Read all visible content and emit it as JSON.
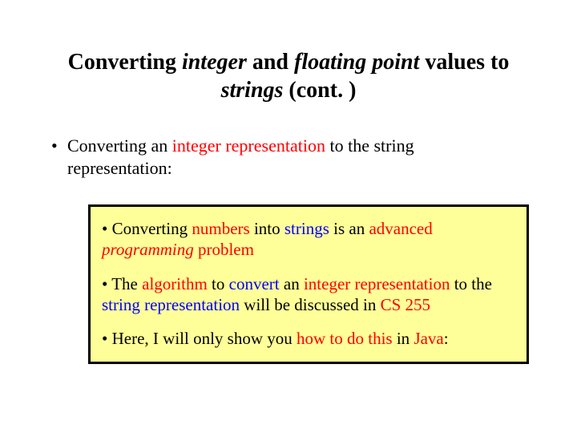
{
  "title": {
    "p1": "Converting ",
    "p2": "integer",
    "p3": " and ",
    "p4": "floating point",
    "p5": " values to ",
    "p6": "strings",
    "p7": " (cont. )"
  },
  "outer": {
    "bullet": "•",
    "t1": "Converting an ",
    "t2": "integer representation",
    "t3": " to the string representation:"
  },
  "box": {
    "i1": {
      "bullet": "• ",
      "a": "Converting ",
      "b": "numbers",
      "c": " into ",
      "d": "strings",
      "e": " is an ",
      "f": "advanced ",
      "g": "programming",
      "h": " problem"
    },
    "i2": {
      "bullet": "• ",
      "a": "The ",
      "b": "algorithm",
      "c": " to ",
      "d": "convert",
      "e": " an ",
      "f": "integer representation",
      "g": " to the ",
      "h": "string representation",
      "i": " will be discussed in ",
      "j": "CS 255"
    },
    "i3": {
      "bullet": "• ",
      "a": "Here, I will only show you ",
      "b": "how to do this",
      "c": " in ",
      "d": "Java",
      "e": ":"
    }
  }
}
